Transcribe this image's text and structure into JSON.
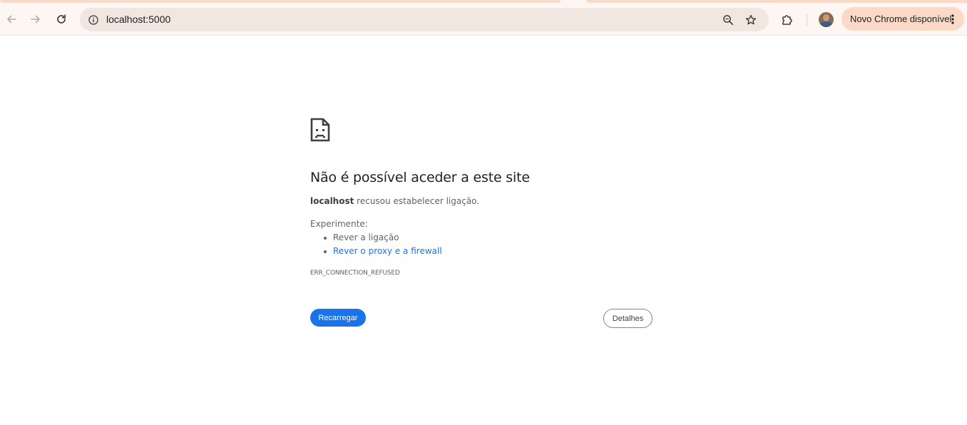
{
  "browser": {
    "url": "localhost:5000",
    "update_chip_label": "Novo Chrome disponível",
    "icons": {
      "back": "arrow-left-icon",
      "forward": "arrow-right-icon",
      "reload": "reload-icon",
      "site_info": "info-icon",
      "zoom": "zoom-icon",
      "bookmark": "star-icon",
      "extensions": "puzzle-icon",
      "menu": "more-vert-icon"
    },
    "colors": {
      "toolbar_bg": "#fdf6f2",
      "omnibox_bg": "#f2e6e0",
      "chip_bg": "#fbd9c7"
    }
  },
  "error_page": {
    "title": "Não é possível aceder a este site",
    "host": "localhost",
    "summary_rest": " recusou estabelecer ligação.",
    "try_heading": "Experimente:",
    "suggestions": [
      {
        "label": "Rever a ligação",
        "is_link": false
      },
      {
        "label": "Rever o proxy e a firewall",
        "is_link": true
      }
    ],
    "error_code": "ERR_CONNECTION_REFUSED",
    "reload_button": "Recarregar",
    "details_button": "Detalhes",
    "colors": {
      "primary": "#1a73e8",
      "text": "#202124",
      "secondary_text": "#5f6368"
    }
  }
}
